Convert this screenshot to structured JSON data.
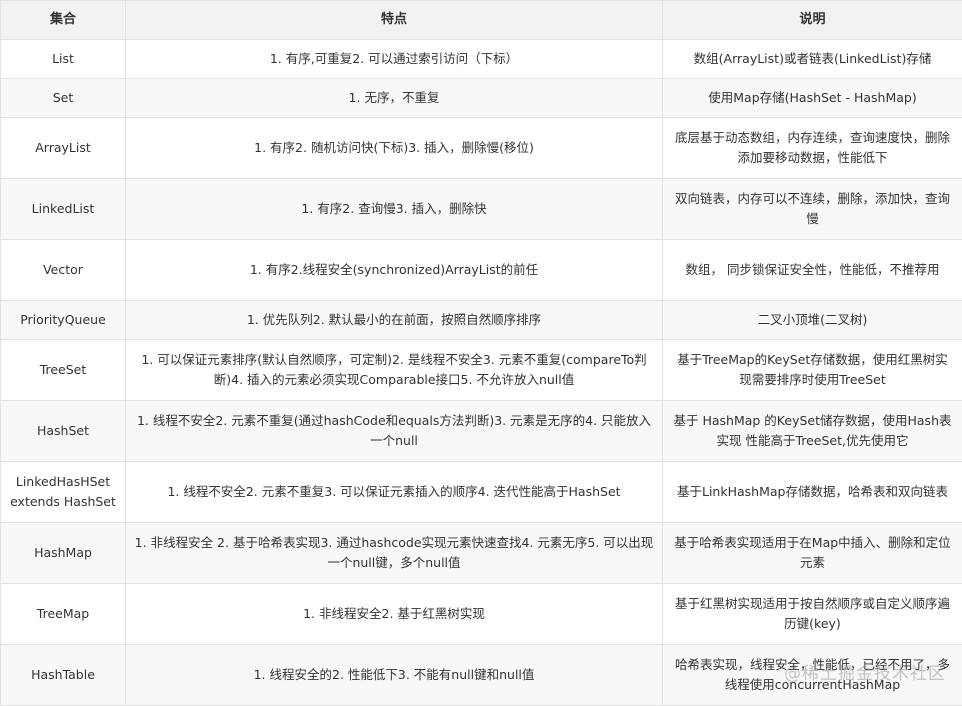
{
  "table": {
    "headers": [
      "集合",
      "特点",
      "说明"
    ],
    "rows": [
      {
        "name": "List",
        "features": "1. 有序,可重复2. 可以通过索引访问（下标）",
        "notes": "数组(ArrayList)或者链表(LinkedList)存储"
      },
      {
        "name": "Set",
        "features": "1. 无序，不重复",
        "notes": "使用Map存储(HashSet - HashMap)"
      },
      {
        "name": "ArrayList",
        "features": "1. 有序2. 随机访问快(下标)3. 插入，删除慢(移位)",
        "notes": "底层基于动态数组，内存连续，查询速度快，删除添加要移动数据，性能低下"
      },
      {
        "name": "LinkedList",
        "features": "1. 有序2. 查询慢3. 插入，删除快",
        "notes": "双向链表，内存可以不连续，删除，添加快，查询慢"
      },
      {
        "name": "Vector",
        "features": "1. 有序2.线程安全(synchronized)ArrayList的前任",
        "notes": "数组， 同步锁保证安全性，性能低，不推荐用"
      },
      {
        "name": "PriorityQueue",
        "features": "1. 优先队列2. 默认最小的在前面，按照自然顺序排序",
        "notes": "二叉小顶堆(二叉树)"
      },
      {
        "name": "TreeSet",
        "features": "1. 可以保证元素排序(默认自然顺序，可定制)2. 是线程不安全3. 元素不重复(compareTo判断)4. 插入的元素必须实现Comparable接口5. 不允许放入null值",
        "notes": "基于TreeMap的KeySet存储数据，使用红黑树实现需要排序时使用TreeSet"
      },
      {
        "name": "HashSet",
        "features": "1. 线程不安全2. 元素不重复(通过hashCode和equals方法判断)3. 元素是无序的4. 只能放入一个null",
        "notes": "基于 HashMap 的KeySet储存数据，使用Hash表实现 性能高于TreeSet,优先使用它"
      },
      {
        "name": "LinkedHasHSet extends HashSet",
        "features": "1. 线程不安全2. 元素不重复3. 可以保证元素插入的顺序4. 迭代性能高于HashSet",
        "notes": "基于LinkHashMap存储数据，哈希表和双向链表"
      },
      {
        "name": "HashMap",
        "features": "1. 非线程安全 2. 基于哈希表实现3. 通过hashcode实现元素快速查找4. 元素无序5. 可以出现一个null键，多个null值",
        "notes": "基于哈希表实现适用于在Map中插入、删除和定位元素"
      },
      {
        "name": "TreeMap",
        "features": "1. 非线程安全2. 基于红黑树实现",
        "notes": "基于红黑树实现适用于按自然顺序或自定义顺序遍历键(key)"
      },
      {
        "name": "HashTable",
        "features": "1. 线程安全的2. 性能低下3. 不能有null键和null值",
        "notes": "哈希表实现，线程安全，性能低，已经不用了，多线程使用concurrentHashMap"
      }
    ]
  },
  "watermark": "@稀土掘金技术社区"
}
